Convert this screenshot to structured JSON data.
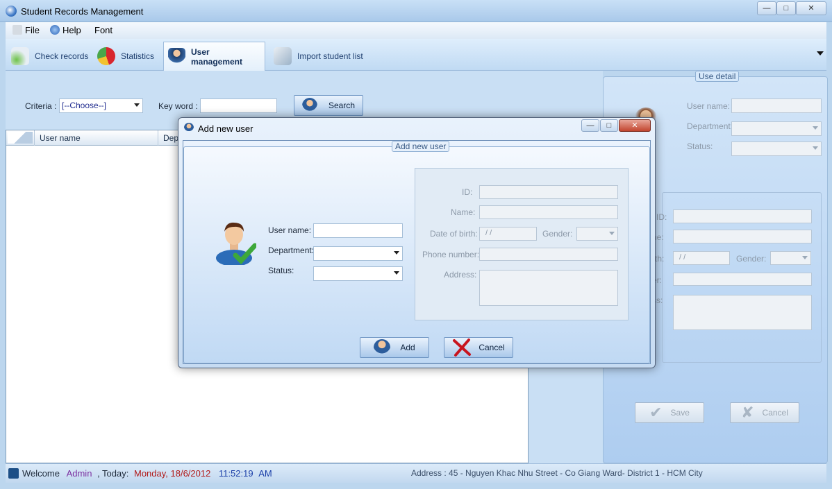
{
  "window": {
    "title": "Student Records Management"
  },
  "menu": {
    "file": "File",
    "help": "Help",
    "font": "Font"
  },
  "tabs": [
    "Check records",
    "Statistics",
    "User management",
    "Import student list"
  ],
  "search": {
    "criteria_label": "Criteria :",
    "criteria_value": "[--Choose--]",
    "keyword_label": "Key word :",
    "keyword_value": "",
    "button": "Search"
  },
  "grid": {
    "columns": [
      "User name",
      "Dep"
    ]
  },
  "detail": {
    "group_title": "Use detail",
    "user_name_label": "User name:",
    "department_label": "Department:",
    "status_label": "Status:",
    "id_label": "ID:",
    "name_label": "ne:",
    "dob_label": "rth:",
    "dob_value": "/ /",
    "gender_label": "Gender:",
    "phone_label": "er:",
    "address_label": "ss:",
    "save_button": "Save",
    "cancel_button": "Cancel"
  },
  "statusbar": {
    "welcome": "Welcome",
    "user": "Admin",
    "today_label": ", Today:",
    "date": "Monday, 18/6/2012",
    "time": "11:52:19",
    "ampm": "AM",
    "address": "Address : 45 - Nguyen Khac Nhu Street - Co Giang Ward- District 1 - HCM City"
  },
  "dialog": {
    "title": "Add new user",
    "group_title": "Add new user",
    "user_name_label": "User name:",
    "user_name_value": "",
    "department_label": "Department:",
    "status_label": "Status:",
    "id_label": "ID:",
    "name_label": "Name:",
    "dob_label": "Date of birth:",
    "dob_value": "/ /",
    "gender_label": "Gender:",
    "phone_label": "Phone number:",
    "address_label": "Address:",
    "add_button": "Add",
    "cancel_button": "Cancel"
  },
  "colors": {
    "accent": "#2c5f9e",
    "status_user": "#7b2fa0",
    "status_date": "#b11a1a",
    "status_time": "#1b3fa8"
  }
}
